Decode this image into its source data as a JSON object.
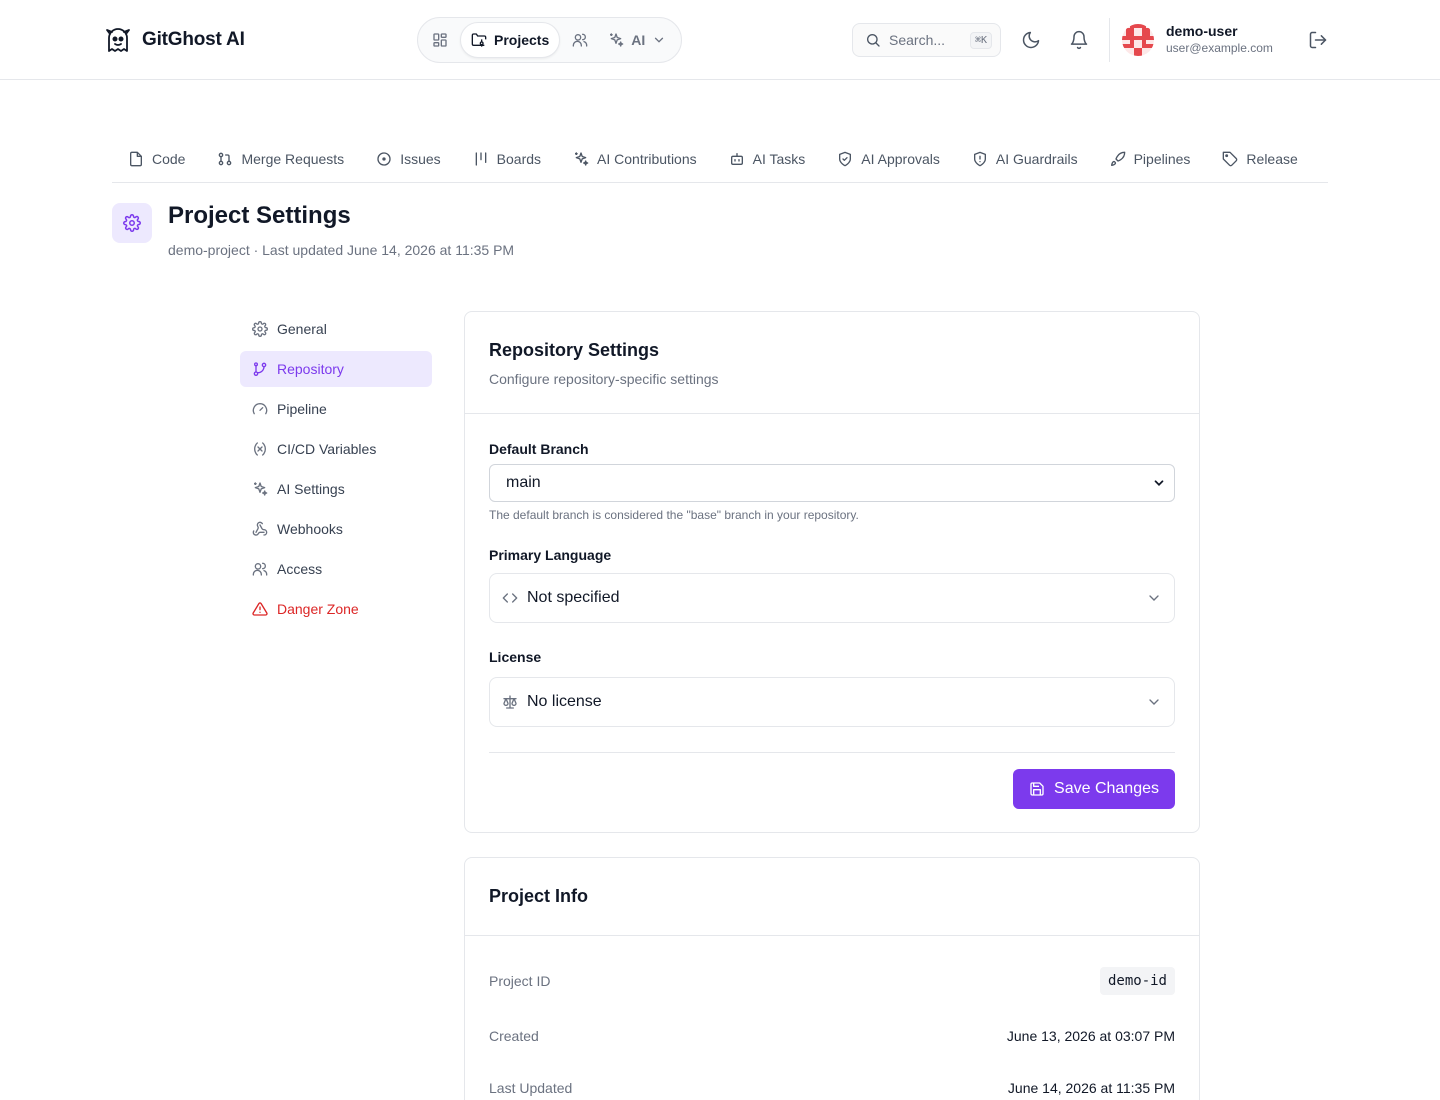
{
  "brand": {
    "name": "GitGhost AI"
  },
  "nav": {
    "active_label": "Projects",
    "ai_label": "AI"
  },
  "search": {
    "placeholder": "Search...",
    "shortcut": "⌘K"
  },
  "user": {
    "name": "demo-user",
    "email": "user@example.com"
  },
  "tabs": [
    {
      "label": "Code",
      "icon": "file-icon"
    },
    {
      "label": "Merge Requests",
      "icon": "git-pull-request-icon"
    },
    {
      "label": "Issues",
      "icon": "circle-dot-icon"
    },
    {
      "label": "Boards",
      "icon": "kanban-icon"
    },
    {
      "label": "AI Contributions",
      "icon": "sparkles-icon"
    },
    {
      "label": "AI Tasks",
      "icon": "bot-icon"
    },
    {
      "label": "AI Approvals",
      "icon": "shield-check-icon"
    },
    {
      "label": "AI Guardrails",
      "icon": "shield-alert-icon"
    },
    {
      "label": "Pipelines",
      "icon": "rocket-icon"
    },
    {
      "label": "Release",
      "icon": "tag-icon"
    }
  ],
  "page": {
    "title": "Project Settings",
    "subtitle": "demo-project · Last updated June 14, 2026 at 11:35 PM"
  },
  "sidebar": {
    "items": [
      {
        "label": "General",
        "icon": "gear-icon"
      },
      {
        "label": "Repository",
        "icon": "git-branch-icon",
        "active": true
      },
      {
        "label": "Pipeline",
        "icon": "gauge-icon"
      },
      {
        "label": "CI/CD Variables",
        "icon": "variable-icon"
      },
      {
        "label": "AI Settings",
        "icon": "sparkles-icon"
      },
      {
        "label": "Webhooks",
        "icon": "webhook-icon"
      },
      {
        "label": "Access",
        "icon": "users-icon"
      },
      {
        "label": "Danger Zone",
        "icon": "warning-triangle-icon",
        "danger": true
      }
    ]
  },
  "repo_settings": {
    "title": "Repository Settings",
    "description": "Configure repository-specific settings",
    "default_branch": {
      "label": "Default Branch",
      "value": "main",
      "help": "The default branch is considered the \"base\" branch in your repository."
    },
    "primary_language": {
      "label": "Primary Language",
      "value": "Not specified"
    },
    "license": {
      "label": "License",
      "value": "No license"
    },
    "save_label": "Save Changes"
  },
  "project_info": {
    "title": "Project Info",
    "rows": [
      {
        "label": "Project ID",
        "value": "demo-id"
      },
      {
        "label": "Created",
        "value": "June 13, 2026 at 03:07 PM"
      },
      {
        "label": "Last Updated",
        "value": "June 14, 2026 at 11:35 PM"
      }
    ]
  },
  "colors": {
    "accent": "#7c3aed",
    "accent_soft": "#ede9fe",
    "danger": "#dc2626",
    "border": "#e5e7eb",
    "text_muted": "#6b7280"
  }
}
